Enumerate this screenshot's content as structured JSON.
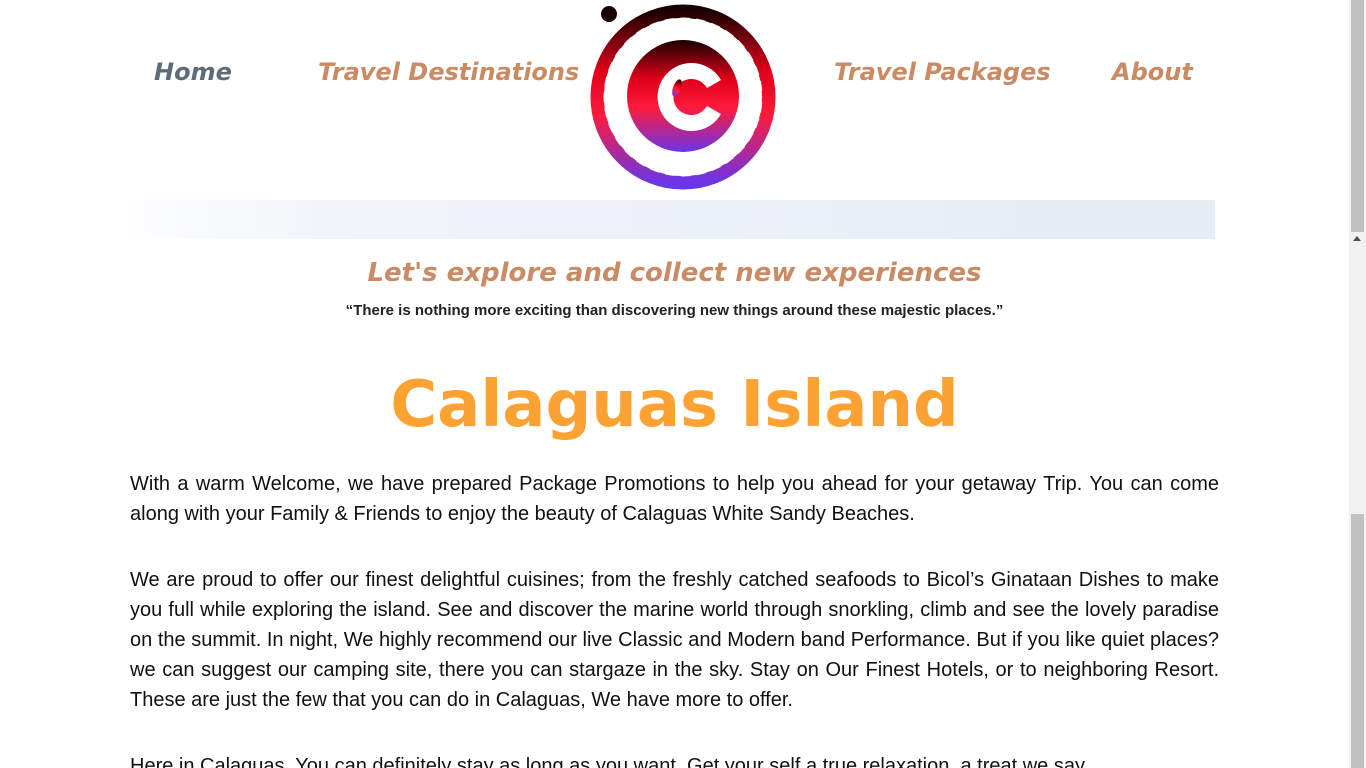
{
  "nav": {
    "home": "Home",
    "destinations": "Travel Destinations",
    "packages": "Travel Packages",
    "about": "About"
  },
  "logo": {
    "icon": "c-logo-icon"
  },
  "hero": {
    "tagline": "Let's explore and collect new experiences",
    "quote": "“There is nothing more exciting than discovering new things around these majestic places.”"
  },
  "content": {
    "title": "Calaguas Island",
    "paragraphs": [
      "With a warm Welcome, we have prepared Package Promotions to help you ahead for your getaway Trip. You can come along with your Family & Friends to enjoy the beauty of Calaguas White Sandy Beaches.",
      "We are proud to offer our finest delightful cuisines; from the freshly catched seafoods to Bicol’s Ginataan Dishes to make you full while exploring the island. See and discover the marine world through snorkling, climb and see the lovely paradise on the summit. In night, We highly recommend our live Classic and Modern band Performance. But if you like quiet places? we can suggest our camping site, there you can stargaze in the sky. Stay on Our Finest Hotels, or to neighboring Resort. These are just the few that you can do in Calaguas, We have more to offer.",
      "Here in Calaguas, You can definitely stay as long as you want. Get your self a true relaxation, a treat we say."
    ]
  },
  "colors": {
    "nav": "#c98a64",
    "nav_active": "#5e6c7a",
    "title": "#fca233"
  }
}
